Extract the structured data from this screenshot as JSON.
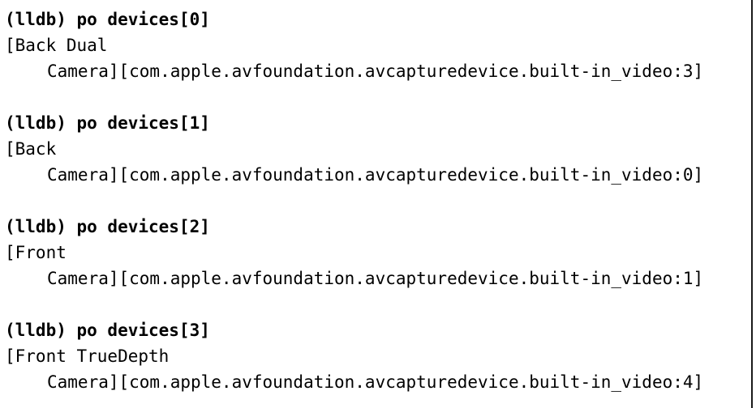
{
  "console": {
    "entries": [
      {
        "command": "(lldb) po devices[0]",
        "output_line1": "[Back Dual",
        "output_line2": "Camera][com.apple.avfoundation.avcapturedevice.built-in_video:3]"
      },
      {
        "command": "(lldb) po devices[1]",
        "output_line1": "[Back",
        "output_line2": "Camera][com.apple.avfoundation.avcapturedevice.built-in_video:0]"
      },
      {
        "command": "(lldb) po devices[2]",
        "output_line1": "[Front",
        "output_line2": "Camera][com.apple.avfoundation.avcapturedevice.built-in_video:1]"
      },
      {
        "command": "(lldb) po devices[3]",
        "output_line1": "[Front TrueDepth",
        "output_line2": "Camera][com.apple.avfoundation.avcapturedevice.built-in_video:4]"
      }
    ]
  }
}
